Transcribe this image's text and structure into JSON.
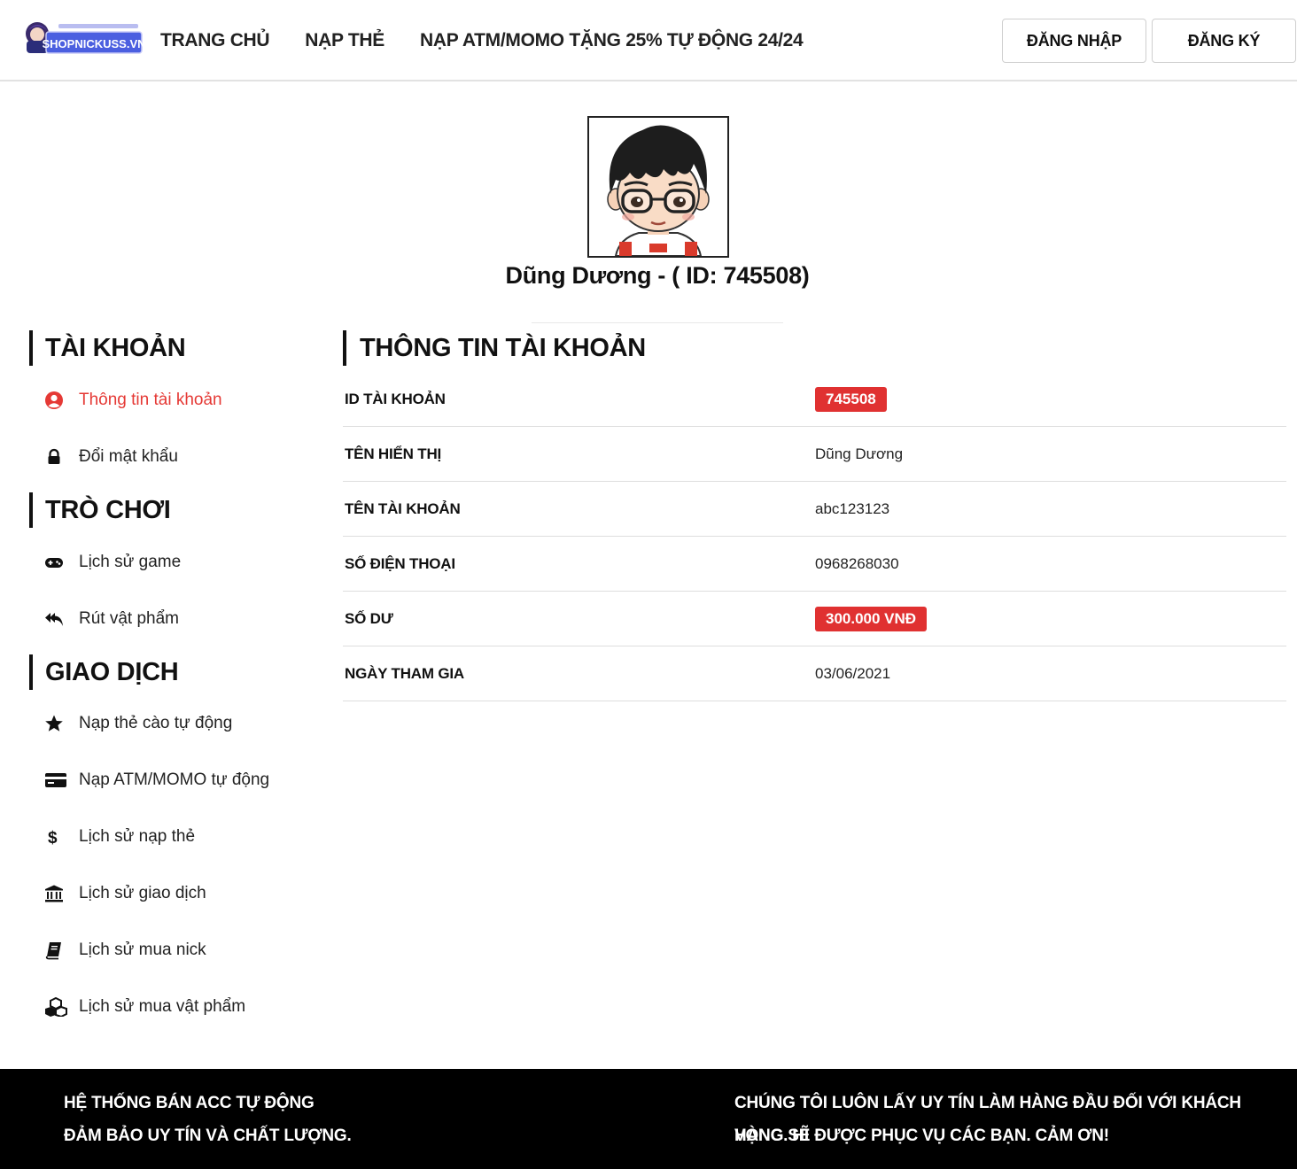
{
  "header": {
    "logo_alt": "SHOPNICKUSS.VN",
    "nav": [
      "TRANG CHỦ",
      "NẠP THẺ",
      "NẠP ATM/MOMO TẶNG 25% TỰ ĐỘNG 24/24"
    ],
    "login_label": "ĐĂNG NHẬP",
    "register_label": "ĐĂNG KÝ"
  },
  "profile": {
    "name_line": "Dũng Dương - ( ID: 745508)"
  },
  "sidebar": {
    "sections": [
      {
        "title": "TÀI KHOẢN",
        "items": [
          {
            "label": "Thông tin tài khoản",
            "icon": "user-circle-icon",
            "active": true
          },
          {
            "label": "Đổi mật khẩu",
            "icon": "lock-icon"
          }
        ]
      },
      {
        "title": "TRÒ CHƠI",
        "items": [
          {
            "label": "Lịch sử game",
            "icon": "gamepad-icon"
          },
          {
            "label": "Rút vật phẩm",
            "icon": "reply-all-icon"
          }
        ]
      },
      {
        "title": "GIAO DỊCH",
        "items": [
          {
            "label": "Nạp thẻ cào tự động",
            "icon": "star-icon"
          },
          {
            "label": "Nạp ATM/MOMO tự động",
            "icon": "credit-card-icon"
          },
          {
            "label": "Lịch sử nạp thẻ",
            "icon": "dollar-icon"
          },
          {
            "label": "Lịch sử giao dịch",
            "icon": "bank-icon"
          },
          {
            "label": "Lịch sử mua nick",
            "icon": "book-icon"
          },
          {
            "label": "Lịch sử mua vật phẩm",
            "icon": "cubes-icon"
          }
        ]
      }
    ]
  },
  "account_info": {
    "title": "THÔNG TIN TÀI KHOẢN",
    "rows": [
      {
        "label": "ID TÀI KHOẢN",
        "value": "745508",
        "badge": true
      },
      {
        "label": "TÊN HIỂN THỊ",
        "value": "Dũng Dương"
      },
      {
        "label": "TÊN TÀI KHOẢN",
        "value": "abc123123"
      },
      {
        "label": "SỐ ĐIỆN THOẠI",
        "value": "0968268030"
      },
      {
        "label": "SỐ DƯ",
        "value": "300.000 VNĐ",
        "badge": true
      },
      {
        "label": "NGÀY THAM GIA",
        "value": "03/06/2021"
      }
    ]
  },
  "footer": {
    "left_line1": "HỆ THỐNG BÁN ACC TỰ ĐỘNG",
    "left_line2": "ĐẢM BẢO UY TÍN VÀ CHẤT LƯỢNG.",
    "right_line1": "CHÚNG TÔI LUÔN LẤY UY TÍN LÀM HÀNG ĐẦU ĐỐI VỚI KHÁCH HÀNG. HI",
    "right_line2": "VỌNG SẼ ĐƯỢC PHỤC VỤ CÁC BẠN. CẢM ƠN!"
  },
  "colors": {
    "accent": "#e53935",
    "badge": "#e03131",
    "footer_bg": "#000000"
  }
}
